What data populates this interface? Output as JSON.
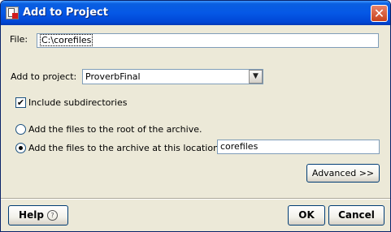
{
  "window": {
    "title": "Add to Project"
  },
  "file": {
    "label": "File:",
    "value": "C:\\corefiles"
  },
  "project": {
    "label": "Add to project:",
    "selected": "ProverbFinal"
  },
  "include_subdirs": {
    "label": "Include subdirectories",
    "checked": true
  },
  "radio_root": {
    "label": "Add the files to the root of the archive.",
    "checked": false
  },
  "radio_location": {
    "label": "Add the files to the archive at this location:",
    "checked": true,
    "value": "corefiles"
  },
  "buttons": {
    "advanced": "Advanced >>",
    "help": "Help",
    "ok": "OK",
    "cancel": "Cancel"
  },
  "icons": {
    "close": "close-icon",
    "help": "question-mark-icon",
    "dropdown": "chevron-down-icon",
    "check": "check-icon"
  },
  "colors": {
    "titlebar": "#0558e6",
    "dialog": "#ece9d8",
    "field_border": "#7f9db9"
  }
}
